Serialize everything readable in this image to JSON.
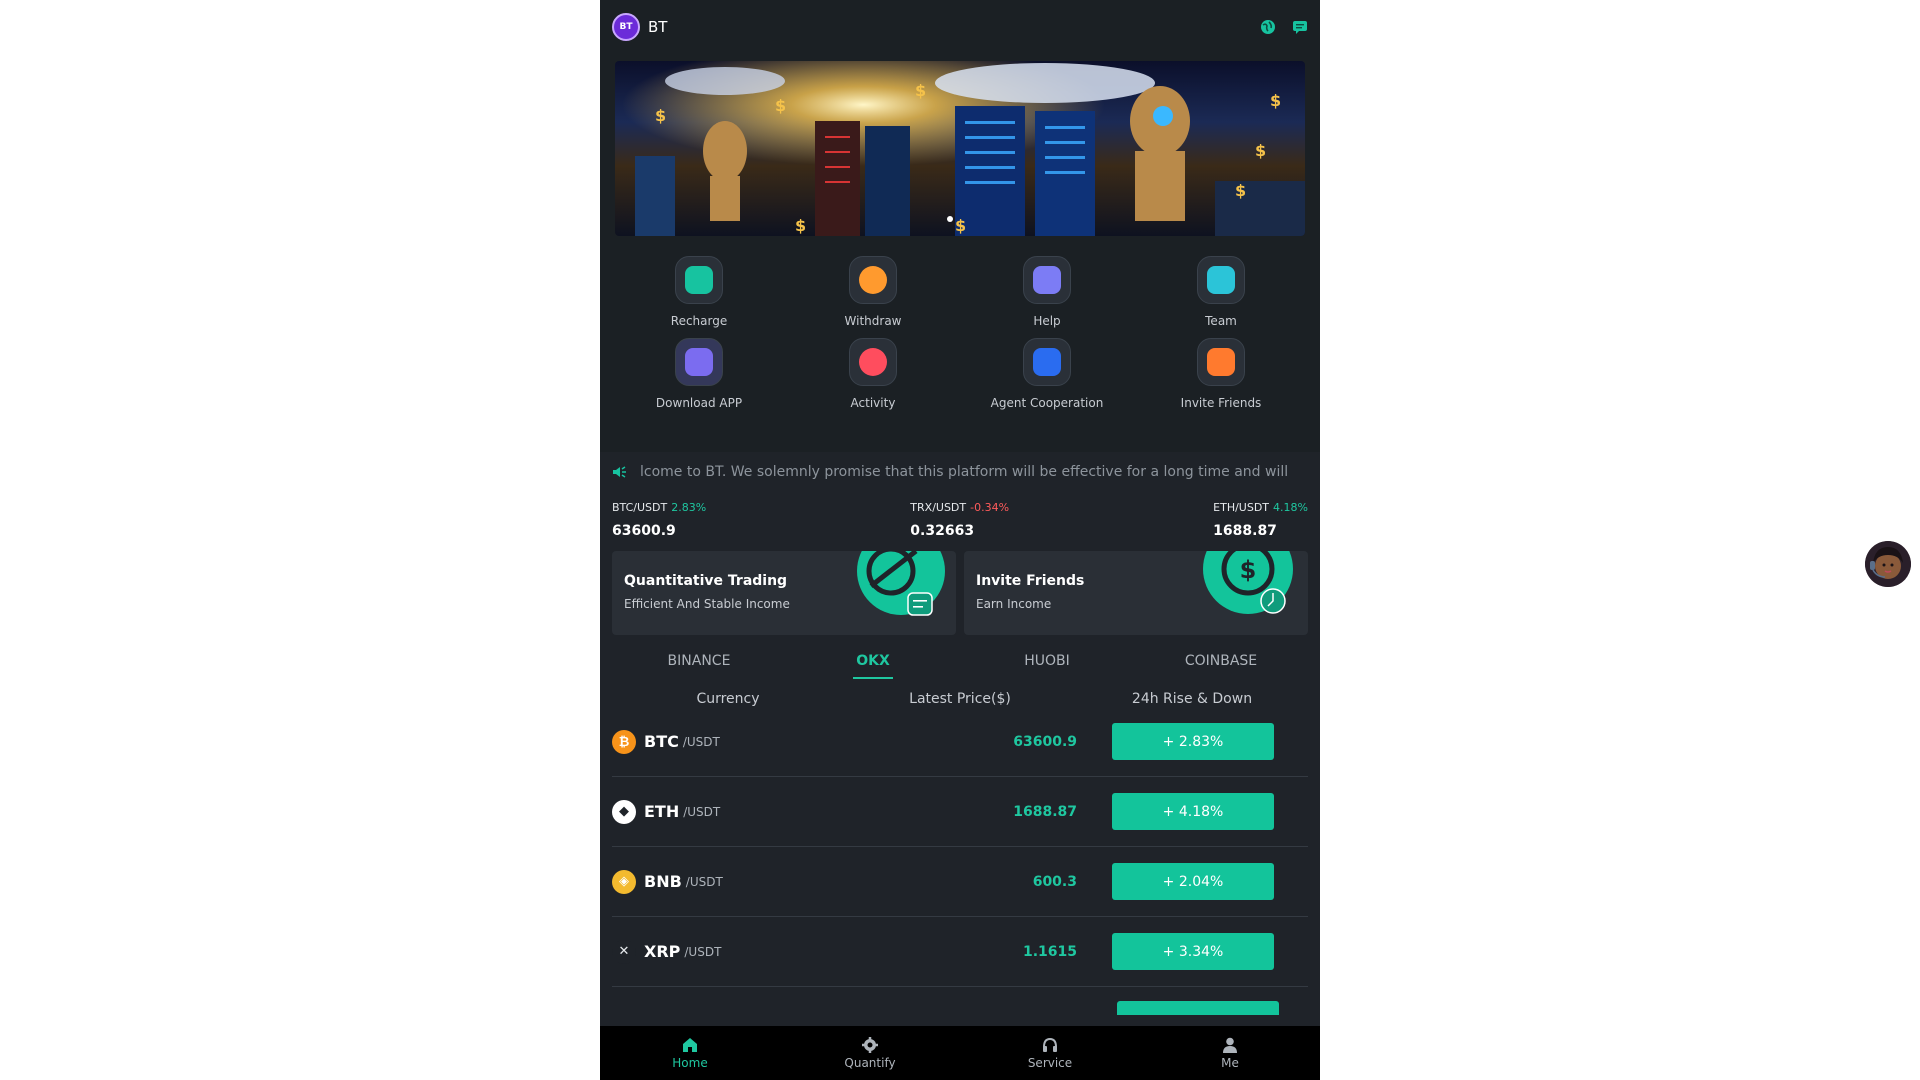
{
  "header": {
    "logo_text": "BT",
    "brand": "BT",
    "icons": [
      "globe-icon",
      "chat-icon"
    ]
  },
  "quick_actions": [
    {
      "label": "Recharge",
      "icon": "wallet-icon",
      "color": "#17c3a0"
    },
    {
      "label": "Withdraw",
      "icon": "coin-hand-icon",
      "color": "#ff9a2e"
    },
    {
      "label": "Help",
      "icon": "book-icon",
      "color": "#7c7cf5"
    },
    {
      "label": "Team",
      "icon": "team-icon",
      "color": "#2bc4d8"
    },
    {
      "label": "Download APP",
      "icon": "download-folder-icon",
      "color": "#7b6cf0"
    },
    {
      "label": "Activity",
      "icon": "flame-icon",
      "color": "#ff4d5e"
    },
    {
      "label": "Agent Cooperation",
      "icon": "agent-icon",
      "color": "#2a6cf0"
    },
    {
      "label": "Invite Friends",
      "icon": "envelope-icon",
      "color": "#ff7a2e"
    }
  ],
  "notice": {
    "icon": "speaker-icon",
    "text": "lcome to BT. We solemnly promise that this platform will be effective for a long time and will never be c"
  },
  "tickers": [
    {
      "pair": "BTC/USDT",
      "change": "2.83%",
      "price": "63600.9",
      "dir": "up"
    },
    {
      "pair": "TRX/USDT",
      "change": "-0.34%",
      "price": "0.32663",
      "dir": "down"
    },
    {
      "pair": "ETH/USDT",
      "change": "4.18%",
      "price": "1688.87",
      "dir": "up"
    }
  ],
  "cards": [
    {
      "title": "Quantitative Trading",
      "subtitle": "Efficient And Stable Income"
    },
    {
      "title": "Invite Friends",
      "subtitle": "Earn Income"
    }
  ],
  "exchange_tabs": [
    "BINANCE",
    "OKX",
    "HUOBI",
    "COINBASE"
  ],
  "active_tab": "OKX",
  "table": {
    "headers": [
      "Currency",
      "Latest Price($)",
      "24h Rise & Down"
    ],
    "rows": [
      {
        "symbol": "BTC",
        "quote": "/USDT",
        "price": "63600.9",
        "change": "+ 2.83%",
        "icon": "bitcoin-icon",
        "icon_color": "#f7931a",
        "glyph": "₿"
      },
      {
        "symbol": "ETH",
        "quote": "/USDT",
        "price": "1688.87",
        "change": "+ 4.18%",
        "icon": "ethereum-icon",
        "icon_color": "#ffffff",
        "glyph": "◆"
      },
      {
        "symbol": "BNB",
        "quote": "/USDT",
        "price": "600.3",
        "change": "+ 2.04%",
        "icon": "bnb-icon",
        "icon_color": "#f3ba2f",
        "glyph": "◈"
      },
      {
        "symbol": "XRP",
        "quote": "/USDT",
        "price": "1.1615",
        "change": "+ 3.34%",
        "icon": "xrp-icon",
        "icon_color": "#1f2329",
        "glyph": "✕"
      }
    ]
  },
  "nav": [
    {
      "label": "Home",
      "icon": "home-icon",
      "active": true
    },
    {
      "label": "Quantify",
      "icon": "gear-icon",
      "active": false
    },
    {
      "label": "Service",
      "icon": "headset-icon",
      "active": false
    },
    {
      "label": "Me",
      "icon": "user-icon",
      "active": false
    }
  ],
  "colors": {
    "accent": "#1fc7a0",
    "down": "#ff5b5b",
    "bg": "#1f2329"
  }
}
